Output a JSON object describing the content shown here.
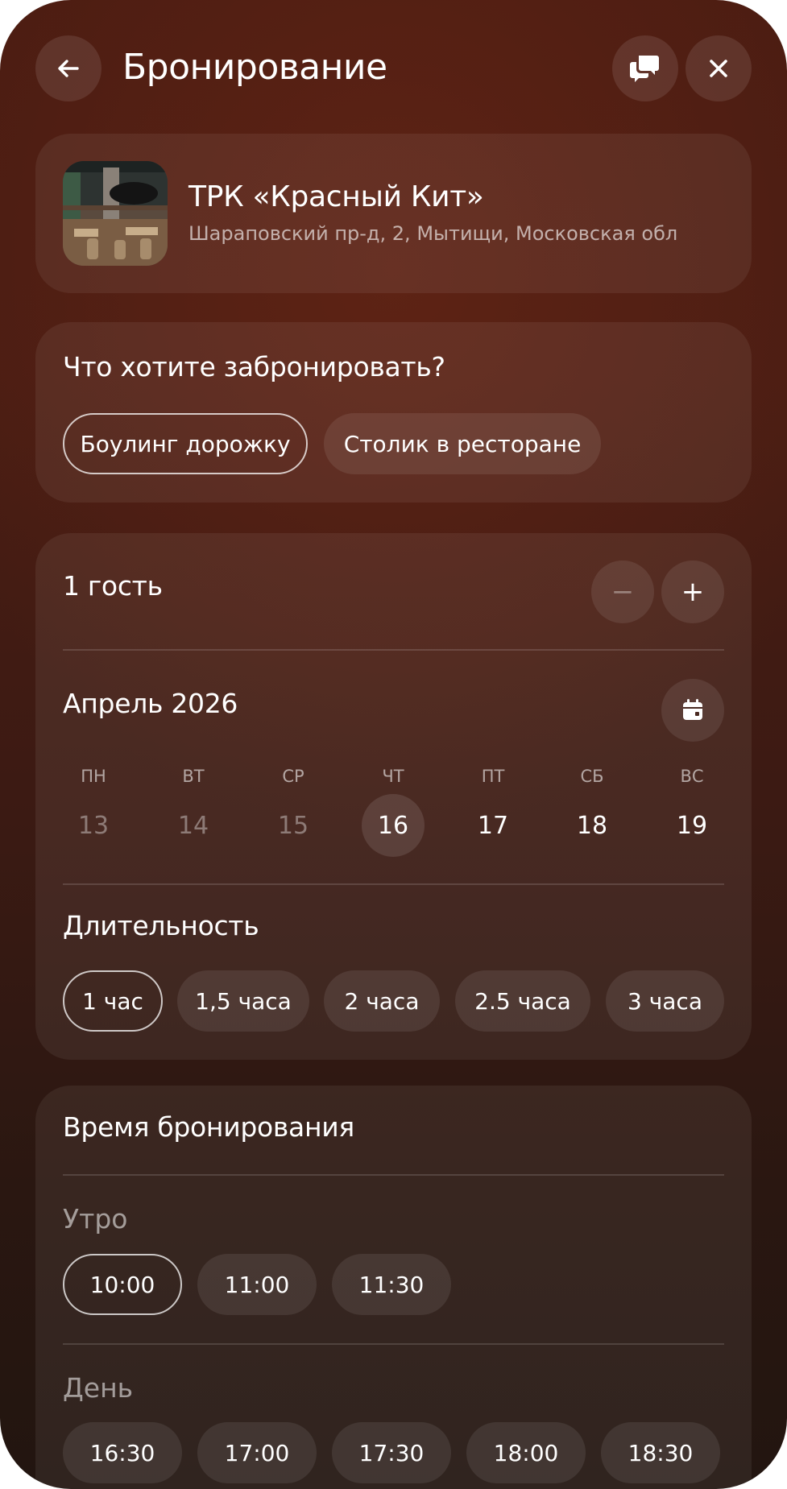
{
  "header": {
    "title": "Бронирование",
    "back_icon": "arrow-left-icon",
    "chat_icon": "chat-bubbles-icon",
    "close_icon": "close-icon"
  },
  "venue": {
    "name": "ТРК «Красный Кит»",
    "address": "Шараповский пр-д, 2, Мытищи, Московская обл"
  },
  "booking_type": {
    "question": "Что хотите забронировать?",
    "options": [
      {
        "label": "Боулинг дорожку",
        "selected": true
      },
      {
        "label": "Столик в ресторане",
        "selected": false
      }
    ]
  },
  "guests": {
    "label": "1 гость",
    "count": 1,
    "minus": "−",
    "plus": "+"
  },
  "calendar": {
    "month": "Апрель 2026",
    "weekdays": [
      "ПН",
      "ВТ",
      "СР",
      "ЧТ",
      "ПТ",
      "СБ",
      "ВС"
    ],
    "days": [
      {
        "num": "13",
        "state": "past"
      },
      {
        "num": "14",
        "state": "past"
      },
      {
        "num": "15",
        "state": "past"
      },
      {
        "num": "16",
        "state": "selected"
      },
      {
        "num": "17",
        "state": "available"
      },
      {
        "num": "18",
        "state": "available"
      },
      {
        "num": "19",
        "state": "available"
      }
    ]
  },
  "duration": {
    "label": "Длительность",
    "options": [
      {
        "label": "1 час",
        "selected": true
      },
      {
        "label": "1,5 часа"
      },
      {
        "label": "2 часа"
      },
      {
        "label": "2.5 часа"
      },
      {
        "label": "3 часа"
      }
    ]
  },
  "time": {
    "title": "Время бронирования",
    "morning": {
      "label": "Утро",
      "slots": [
        {
          "label": "10:00",
          "selected": true
        },
        {
          "label": "11:00"
        },
        {
          "label": "11:30"
        }
      ]
    },
    "day": {
      "label": "День",
      "slots": [
        {
          "label": "16:30"
        },
        {
          "label": "17:00"
        },
        {
          "label": "17:30"
        },
        {
          "label": "18:00"
        },
        {
          "label": "18:30"
        }
      ]
    }
  }
}
